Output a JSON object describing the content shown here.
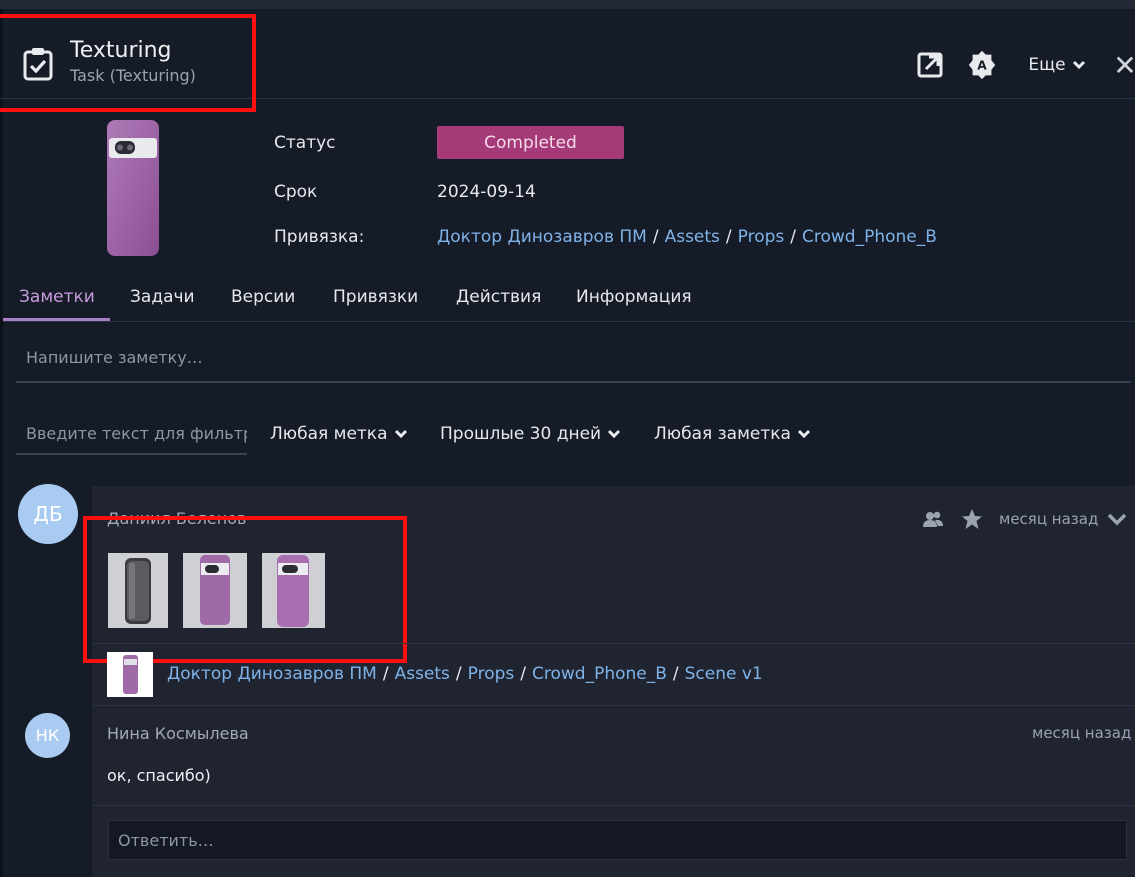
{
  "header": {
    "title": "Texturing",
    "subtitle": "Task (Texturing)",
    "more_label": "Еще",
    "close_glyph": "✕"
  },
  "info": {
    "status_label": "Статус",
    "status_value": "Completed",
    "status_color": "#a53a78",
    "due_label": "Срок",
    "due_value": "2024-09-14",
    "link_label": "Привязка:",
    "link_path": [
      "Доктор Динозавров ПМ",
      "Assets",
      "Props",
      "Crowd_Phone_B"
    ]
  },
  "tabs": [
    {
      "label": "Заметки",
      "active": true
    },
    {
      "label": "Задачи"
    },
    {
      "label": "Версии"
    },
    {
      "label": "Привязки"
    },
    {
      "label": "Действия"
    },
    {
      "label": "Информация"
    }
  ],
  "note_input": {
    "placeholder": "Напишите заметку…"
  },
  "filters": {
    "search_placeholder": "Введите текст для фильтрации",
    "tag": "Любая метка",
    "period": "Прошлые 30 дней",
    "note_type": "Любая заметка"
  },
  "thread": {
    "note": {
      "avatar_initials": "ДБ",
      "author": "Даниил Беленов",
      "time": "месяц назад",
      "icons": [
        "people-icon",
        "star-icon",
        "chevron-down-icon"
      ],
      "attachments": [
        "phone-dark-thumbnail",
        "phone-purple-back-thumbnail",
        "phone-purple-back-thumbnail"
      ],
      "link_path": [
        "Доктор Динозавров ПМ",
        "Assets",
        "Props",
        "Crowd_Phone_B",
        "Scene v1"
      ]
    },
    "reply": {
      "avatar_initials": "НК",
      "author": "Нина Космылева",
      "time": "месяц назад",
      "text": "ок, спасибо)"
    },
    "reply_input": {
      "placeholder": "Ответить…"
    }
  },
  "colors": {
    "accent_tab": "#c79be0",
    "link": "#7fb3e8",
    "highlight_box": "#ff1010",
    "avatar_bg": "#a9cbf2"
  }
}
